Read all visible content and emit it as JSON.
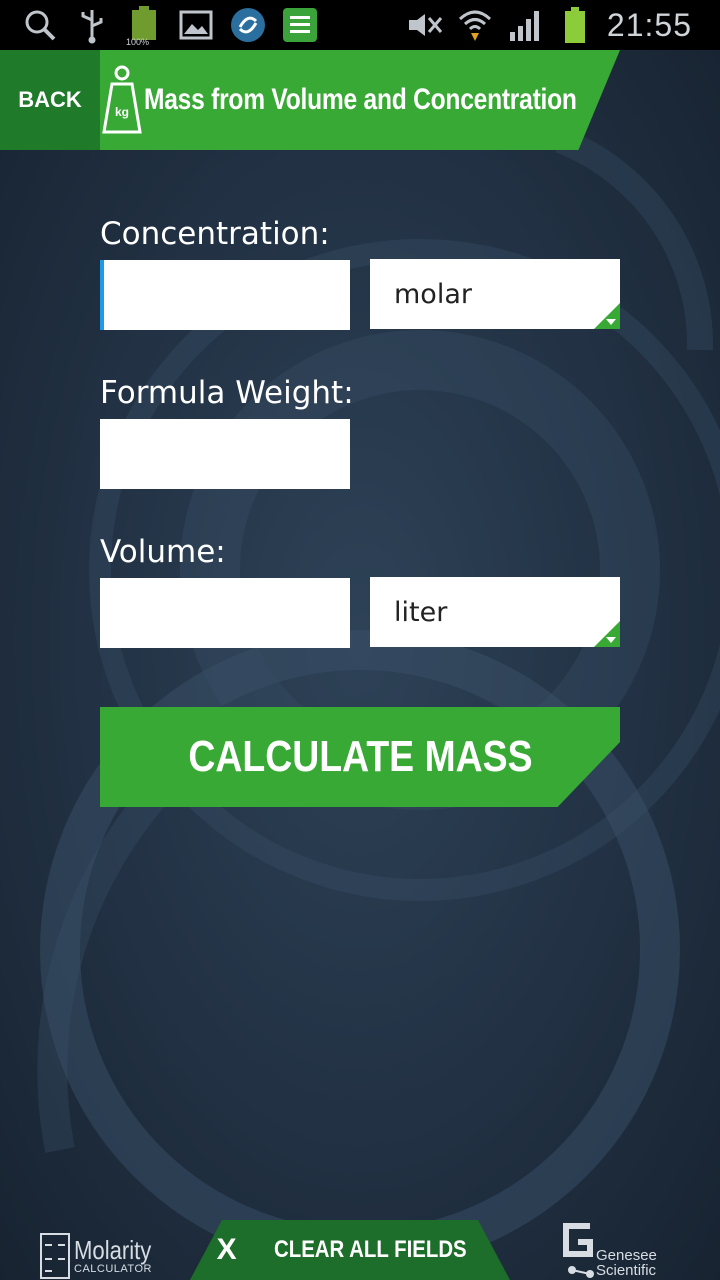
{
  "status_bar": {
    "time": "21:55",
    "battery_small_label": "100%",
    "icons": [
      "search-icon",
      "usb-icon",
      "battery-full-icon",
      "gallery-icon",
      "sync-app-icon",
      "app-icon",
      "mute-icon",
      "wifi-icon",
      "signal-icon",
      "battery-icon"
    ]
  },
  "header": {
    "back_label": "BACK",
    "title": "Mass from Volume and Concentration",
    "icon": "weight-kg-icon",
    "icon_text": "kg"
  },
  "form": {
    "concentration": {
      "label": "Concentration:",
      "value": "",
      "unit": "molar"
    },
    "formula_weight": {
      "label": "Formula Weight:",
      "value": ""
    },
    "volume": {
      "label": "Volume:",
      "value": "",
      "unit": "liter"
    }
  },
  "calculate_button": {
    "label": "CALCULATE MASS"
  },
  "footer": {
    "app_logo_name": "Molarity",
    "app_logo_sub": "CALCULATOR",
    "clear_icon": "X",
    "clear_label": "CLEAR ALL FIELDS",
    "brand_line1": "Genesee",
    "brand_line2": "Scientific"
  },
  "colors": {
    "accent_green": "#39a935",
    "dark_green": "#1f7a2a",
    "background": "#243447",
    "focus_blue": "#1e9be8"
  }
}
